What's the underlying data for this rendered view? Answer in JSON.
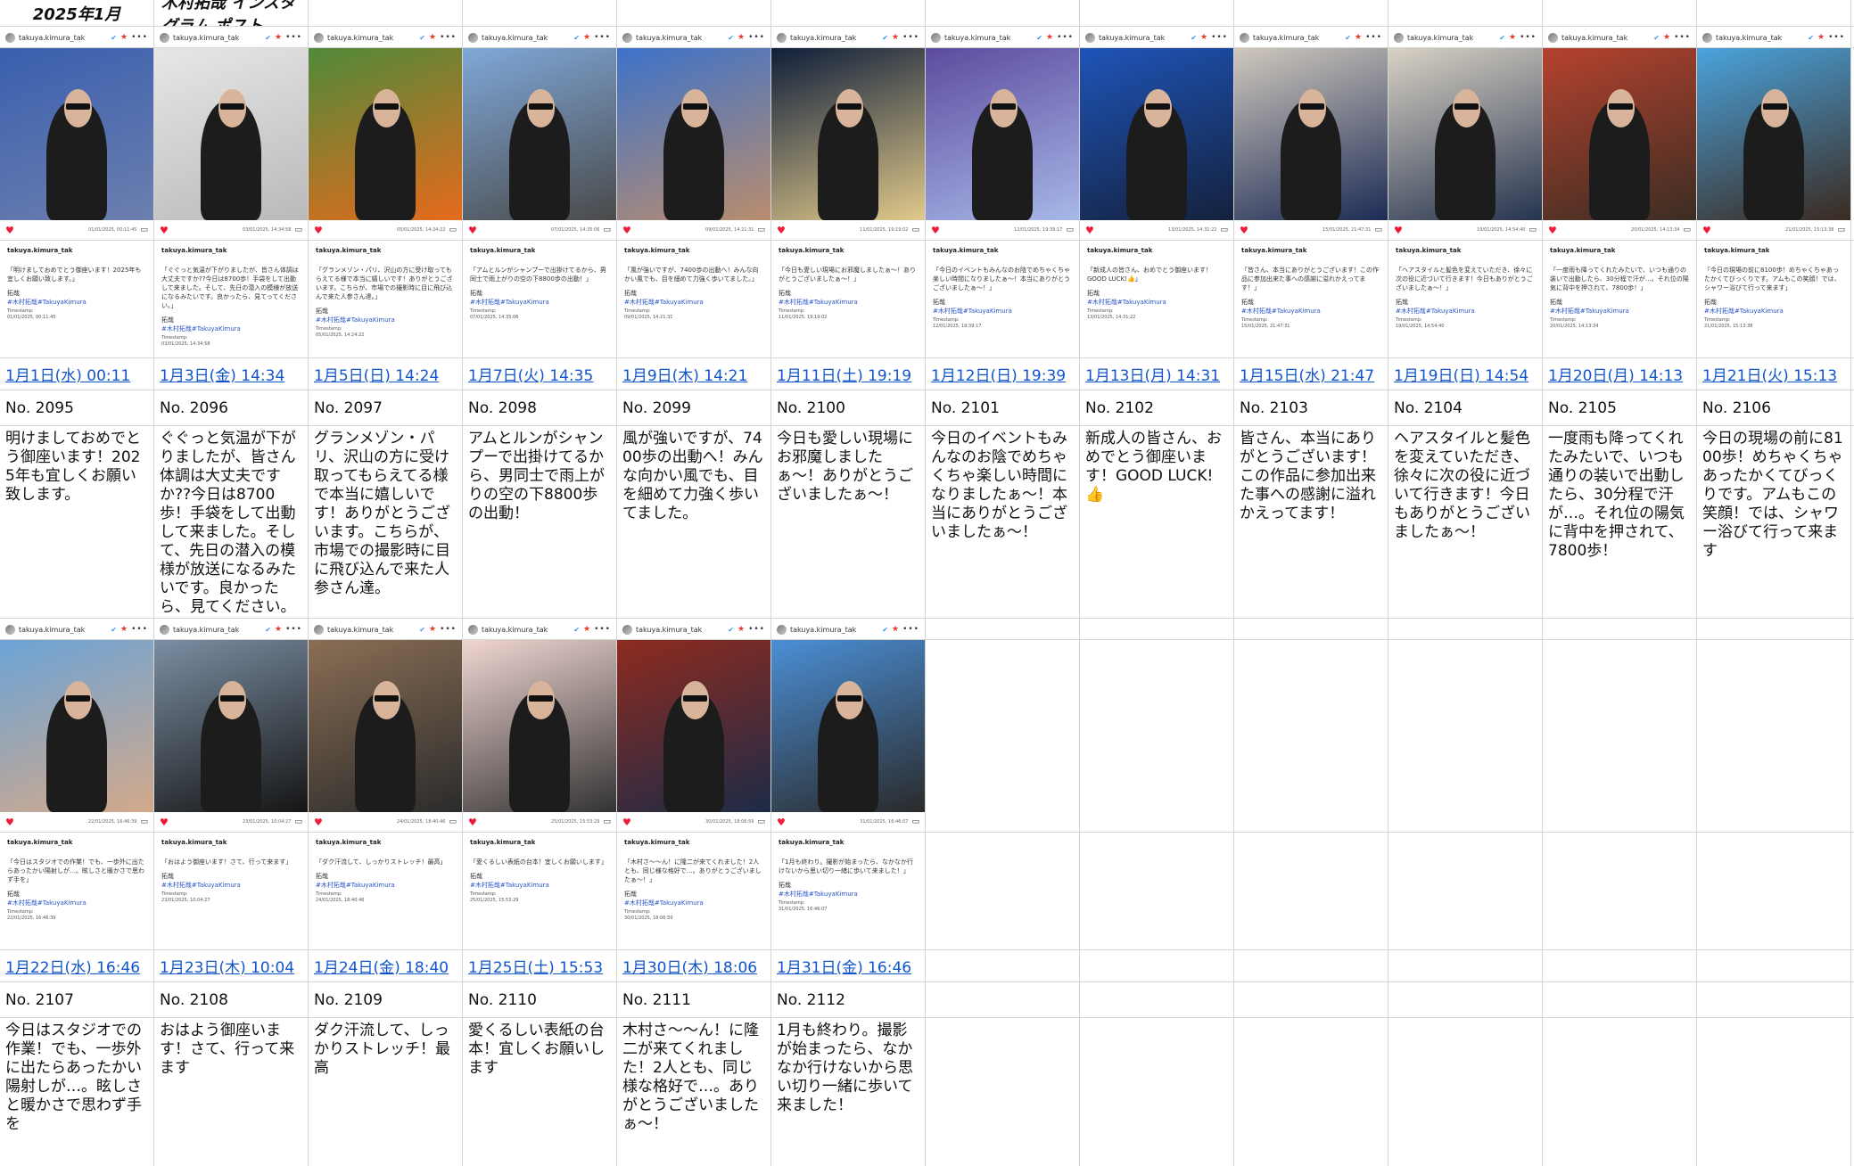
{
  "header": {
    "month": "2025年1月",
    "title": "木村拓哉 インスタグラム ポスト"
  },
  "ig": {
    "username": "takuya.kimura_tak",
    "verified": "✔",
    "star": "★",
    "dots": "•••",
    "heart": "♥",
    "bookmark": "▭",
    "sig": "拓哉",
    "hashtag": "#木村拓哉#TakuyaKimura",
    "timestamp_label": "Timestamp:"
  },
  "posts": [
    {
      "date": "1月1日(水) 00:11",
      "no": "No. 2095",
      "text": "明けましておめでとう御座います！2025年も宜しくお願い致します。",
      "thumb_caption": "「明けましておめでとう御座います！2025年も宜しくお願い致します。」",
      "thumb_ts": "01/01/2025, 00:11:45",
      "photo": {
        "sky": "#3a5fae",
        "tone": "#6c7fae"
      }
    },
    {
      "date": "1月3日(金) 14:34",
      "no": "No. 2096",
      "text": "ぐぐっと気温が下がりましたが、皆さん体調は大丈夫ですか??今日は8700歩！手袋をして出動して来ました。そして、先日の潜入の模様が放送になるみたいです。良かったら、見てください。",
      "thumb_caption": "「ぐぐっと気温が下がりましたが、皆さん体調は大丈夫ですか??今日は8700歩！手袋をして出動して来ました。そして、先日の潜入の模様が放送になるみたいです。良かったら、見てってください。」",
      "thumb_ts": "03/01/2025, 14:34:58",
      "photo": {
        "sky": "#e7e7e7",
        "tone": "#b9b9b9"
      }
    },
    {
      "date": "1月5日(日) 14:24",
      "no": "No. 2097",
      "text": "グランメゾン・パリ、沢山の方に受け取ってもらえてる様で本当に嬉しいです！ありがとうございます。こちらが、市場での撮影時に目に飛び込んで来た人参さん達。",
      "thumb_caption": "「グランメゾン・パリ、沢山の方に受け取ってもらえてる様で本当に嬉しいです！ありがとうございます。こちらが、市場での撮影時に目に飛び込んで来た人参さん達。」",
      "thumb_ts": "05/01/2025, 14:24:22",
      "photo": {
        "sky": "#4f8a3a",
        "tone": "#e66a1c"
      }
    },
    {
      "date": "1月7日(火) 14:35",
      "no": "No. 2098",
      "text": "アムとルンがシャンプーで出掛けてるから、男同士で雨上がりの空の下8800歩の出動！",
      "thumb_caption": "「アムとルンがシャンプーで出掛けてるから、男同士で雨上がりの空の下8800歩の出動！」",
      "thumb_ts": "07/01/2025, 14:35:06",
      "photo": {
        "sky": "#7fa8d9",
        "tone": "#4a4a4a"
      }
    },
    {
      "date": "1月9日(木) 14:21",
      "no": "No. 2099",
      "text": "風が強いですが、7400歩の出動へ！みんな向かい風でも、目を細めて力強く歩いてました。",
      "thumb_caption": "「風が強いですが、7400歩の出動へ！みんな向かい風でも、目を細めて力強く歩いてました。」",
      "thumb_ts": "09/01/2025, 14:21:31",
      "photo": {
        "sky": "#3d72c9",
        "tone": "#b98d6e"
      }
    },
    {
      "date": "1月11日(土) 19:19",
      "no": "No. 2100",
      "text": "今日も愛しい現場にお邪魔しましたぁ〜！ありがとうございましたぁ〜！",
      "thumb_caption": "「今日も愛しい現場にお邪魔しましたぁ〜！ありがとうございましたぁ〜！」",
      "thumb_ts": "11/01/2025, 19:19:02",
      "photo": {
        "sky": "#0f1e3a",
        "tone": "#e1c98a"
      }
    },
    {
      "date": "1月12日(日) 19:39",
      "no": "No. 2101",
      "text": "今日のイベントもみんなのお陰でめちゃくちゃ楽しい時間になりましたぁ〜！本当にありがとうございましたぁ〜！",
      "thumb_caption": "「今日のイベントもみんなのお陰でめちゃくちゃ楽しい時間になりましたぁ〜！本当にありがとうございましたぁ〜！」",
      "thumb_ts": "12/01/2025, 19:39:17",
      "photo": {
        "sky": "#5d4b9e",
        "tone": "#a7b8e8"
      }
    },
    {
      "date": "1月13日(月) 14:31",
      "no": "No. 2102",
      "text": "新成人の皆さん、おめでとう御座います！GOOD LUCK!👍",
      "thumb_caption": "「新成人の皆さん、おめでとう御座います！GOOD LUCK!👍」",
      "thumb_ts": "13/01/2025, 14:31:22",
      "photo": {
        "sky": "#1f54b8",
        "tone": "#14213d"
      }
    },
    {
      "date": "1月15日(水) 21:47",
      "no": "No. 2103",
      "text": "皆さん、本当にありがとうございます！この作品に参加出来た事への感謝に溢れかえってます！",
      "thumb_caption": "「皆さん、本当にありがとうございます！この作品に参加出来た事への感謝に溢れかえってます！」",
      "thumb_ts": "15/01/2025, 21:47:31",
      "photo": {
        "sky": "#cfc8bd",
        "tone": "#1d2b55"
      }
    },
    {
      "date": "1月19日(日) 14:54",
      "no": "No. 2104",
      "text": "ヘアスタイルと髪色を変えていただき、徐々に次の役に近づいて行きます！今日もありがとうございましたぁ〜！",
      "thumb_caption": "「ヘアスタイルと髪色を変えていただき、徐々に次の役に近づいて行きます！今日もありがとうございましたぁ〜！」",
      "thumb_ts": "19/01/2025, 14:54:40",
      "photo": {
        "sky": "#d9d2c5",
        "tone": "#26344f"
      }
    },
    {
      "date": "1月20日(月) 14:13",
      "no": "No. 2105",
      "text": "一度雨も降ってくれたみたいで、いつも通りの装いで出動したら、30分程で汗が…。それ位の陽気に背中を押されて、7800歩！",
      "thumb_caption": "「一度雨も降ってくれたみたいで、いつも通りの装いで出動したら、30分程で汗が…。それ位の陽気に背中を押されて、7800歩！」",
      "thumb_ts": "20/01/2025, 14:13:34",
      "photo": {
        "sky": "#b5422e",
        "tone": "#3b2d23"
      }
    },
    {
      "date": "1月21日(火) 15:13",
      "no": "No. 2106",
      "text": "今日の現場の前に8100歩！めちゃくちゃあったかくてびっくりです。アムもこの笑顔！では、シャワー浴びて行って来ます",
      "thumb_caption": "「今日の現場の前に8100歩！めちゃくちゃあったかくてびっくりです。アムもこの笑顔！では、シャワー浴びて行って来ます」",
      "thumb_ts": "21/01/2025, 15:13:38",
      "photo": {
        "sky": "#4aa3dc",
        "tone": "#3b2a20"
      }
    },
    {
      "date": "1月22日(水) 16:46",
      "no": "No. 2107",
      "text": "今日はスタジオでの作業！でも、一歩外に出たらあったかい陽射しが…。眩しさと暖かさで思わず手を",
      "thumb_caption": "「今日はスタジオでの作業！でも、一歩外に出たらあったかい陽射しが…。眩しさと暖かさで思わず手を」",
      "thumb_ts": "22/01/2025, 16:46:39",
      "photo": {
        "sky": "#6ba3d6",
        "tone": "#d3a98a"
      }
    },
    {
      "date": "1月23日(木) 10:04",
      "no": "No. 2108",
      "text": "おはよう御座います！さて、行って来ます",
      "thumb_caption": "「おはよう御座います！さて、行って来ます」",
      "thumb_ts": "23/01/2025, 10:04:27",
      "photo": {
        "sky": "#7b8ea3",
        "tone": "#151515"
      }
    },
    {
      "date": "1月24日(金) 18:40",
      "no": "No. 2109",
      "text": "ダク汗流して、しっかりストレッチ！最高",
      "thumb_caption": "「ダク汗流して、しっかりストレッチ！最高」",
      "thumb_ts": "24/01/2025, 18:40:46",
      "photo": {
        "sky": "#8a6e54",
        "tone": "#2b2b2b"
      }
    },
    {
      "date": "1月25日(土) 15:53",
      "no": "No. 2110",
      "text": "愛くるしい表紙の台本！宜しくお願いします",
      "thumb_caption": "「愛くるしい表紙の台本！宜しくお願いします」",
      "thumb_ts": "25/01/2025, 15:53:29",
      "photo": {
        "sky": "#f1d6d2",
        "tone": "#333"
      }
    },
    {
      "date": "1月30日(木) 18:06",
      "no": "No. 2111",
      "text": "木村さ〜〜ん！に隆二が来てくれました！2人とも、同じ様な格好で…。ありがとうございましたぁ〜！",
      "thumb_caption": "「木村さ〜〜ん！に隆二が来てくれました！2人とも、同じ様な格好で…。ありがとうございましたぁ〜！」",
      "thumb_ts": "30/01/2025, 18:06:59",
      "photo": {
        "sky": "#8e2b1f",
        "tone": "#1d2b47"
      }
    },
    {
      "date": "1月31日(金) 16:46",
      "no": "No. 2112",
      "text": "1月も終わり。撮影が始まったら、なかなか行けないから思い切り一緒に歩いて来ました！",
      "thumb_caption": "「1月も終わり。撮影が始まったら、なかなか行けないから思い切り一緒に歩いて来ました！」",
      "thumb_ts": "31/01/2025, 16:46:07",
      "photo": {
        "sky": "#4b8fd6",
        "tone": "#2a2a2a"
      }
    }
  ]
}
